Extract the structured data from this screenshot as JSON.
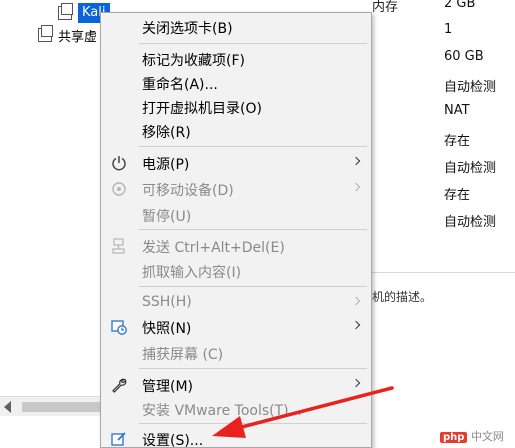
{
  "tree": {
    "selected_vm": "Kali",
    "shared_label": "共享虚"
  },
  "properties": {
    "rows": [
      {
        "left": "内存",
        "right": "2 GB"
      },
      {
        "left": "",
        "right": "1"
      },
      {
        "left": "",
        "right": "60 GB"
      },
      {
        "left": "",
        "right": "自动检测"
      },
      {
        "left": "",
        "right": "NAT"
      },
      {
        "left": "",
        "right": "存在"
      },
      {
        "left": "",
        "right": "自动检测"
      },
      {
        "left": "",
        "right": "存在"
      },
      {
        "left": "",
        "right": "自动检测"
      }
    ],
    "description_fragment": "机的描述。"
  },
  "menu": {
    "close_tab": "关闭选项卡(B)",
    "favorite": "标记为收藏项(F)",
    "rename": "重命名(A)...",
    "open_dir": "打开虚拟机目录(O)",
    "remove": "移除(R)",
    "power": "电源(P)",
    "removable": "可移动设备(D)",
    "pause": "暂停(U)",
    "send_cad": "发送 Ctrl+Alt+Del(E)",
    "grab_input": "抓取输入内容(I)",
    "ssh": "SSH(H)",
    "snapshot": "快照(N)",
    "capture_screen": "捕获屏幕 (C)",
    "manage": "管理(M)",
    "install_tools": "安装 VMware Tools(T)...",
    "settings": "设置(S)..."
  },
  "colors": {
    "selection": "#0a64d8",
    "annotation_arrow": "#e8231f",
    "menu_bg": "#f2f2f2"
  },
  "watermark": {
    "brand": "php",
    "site": "中文网"
  }
}
